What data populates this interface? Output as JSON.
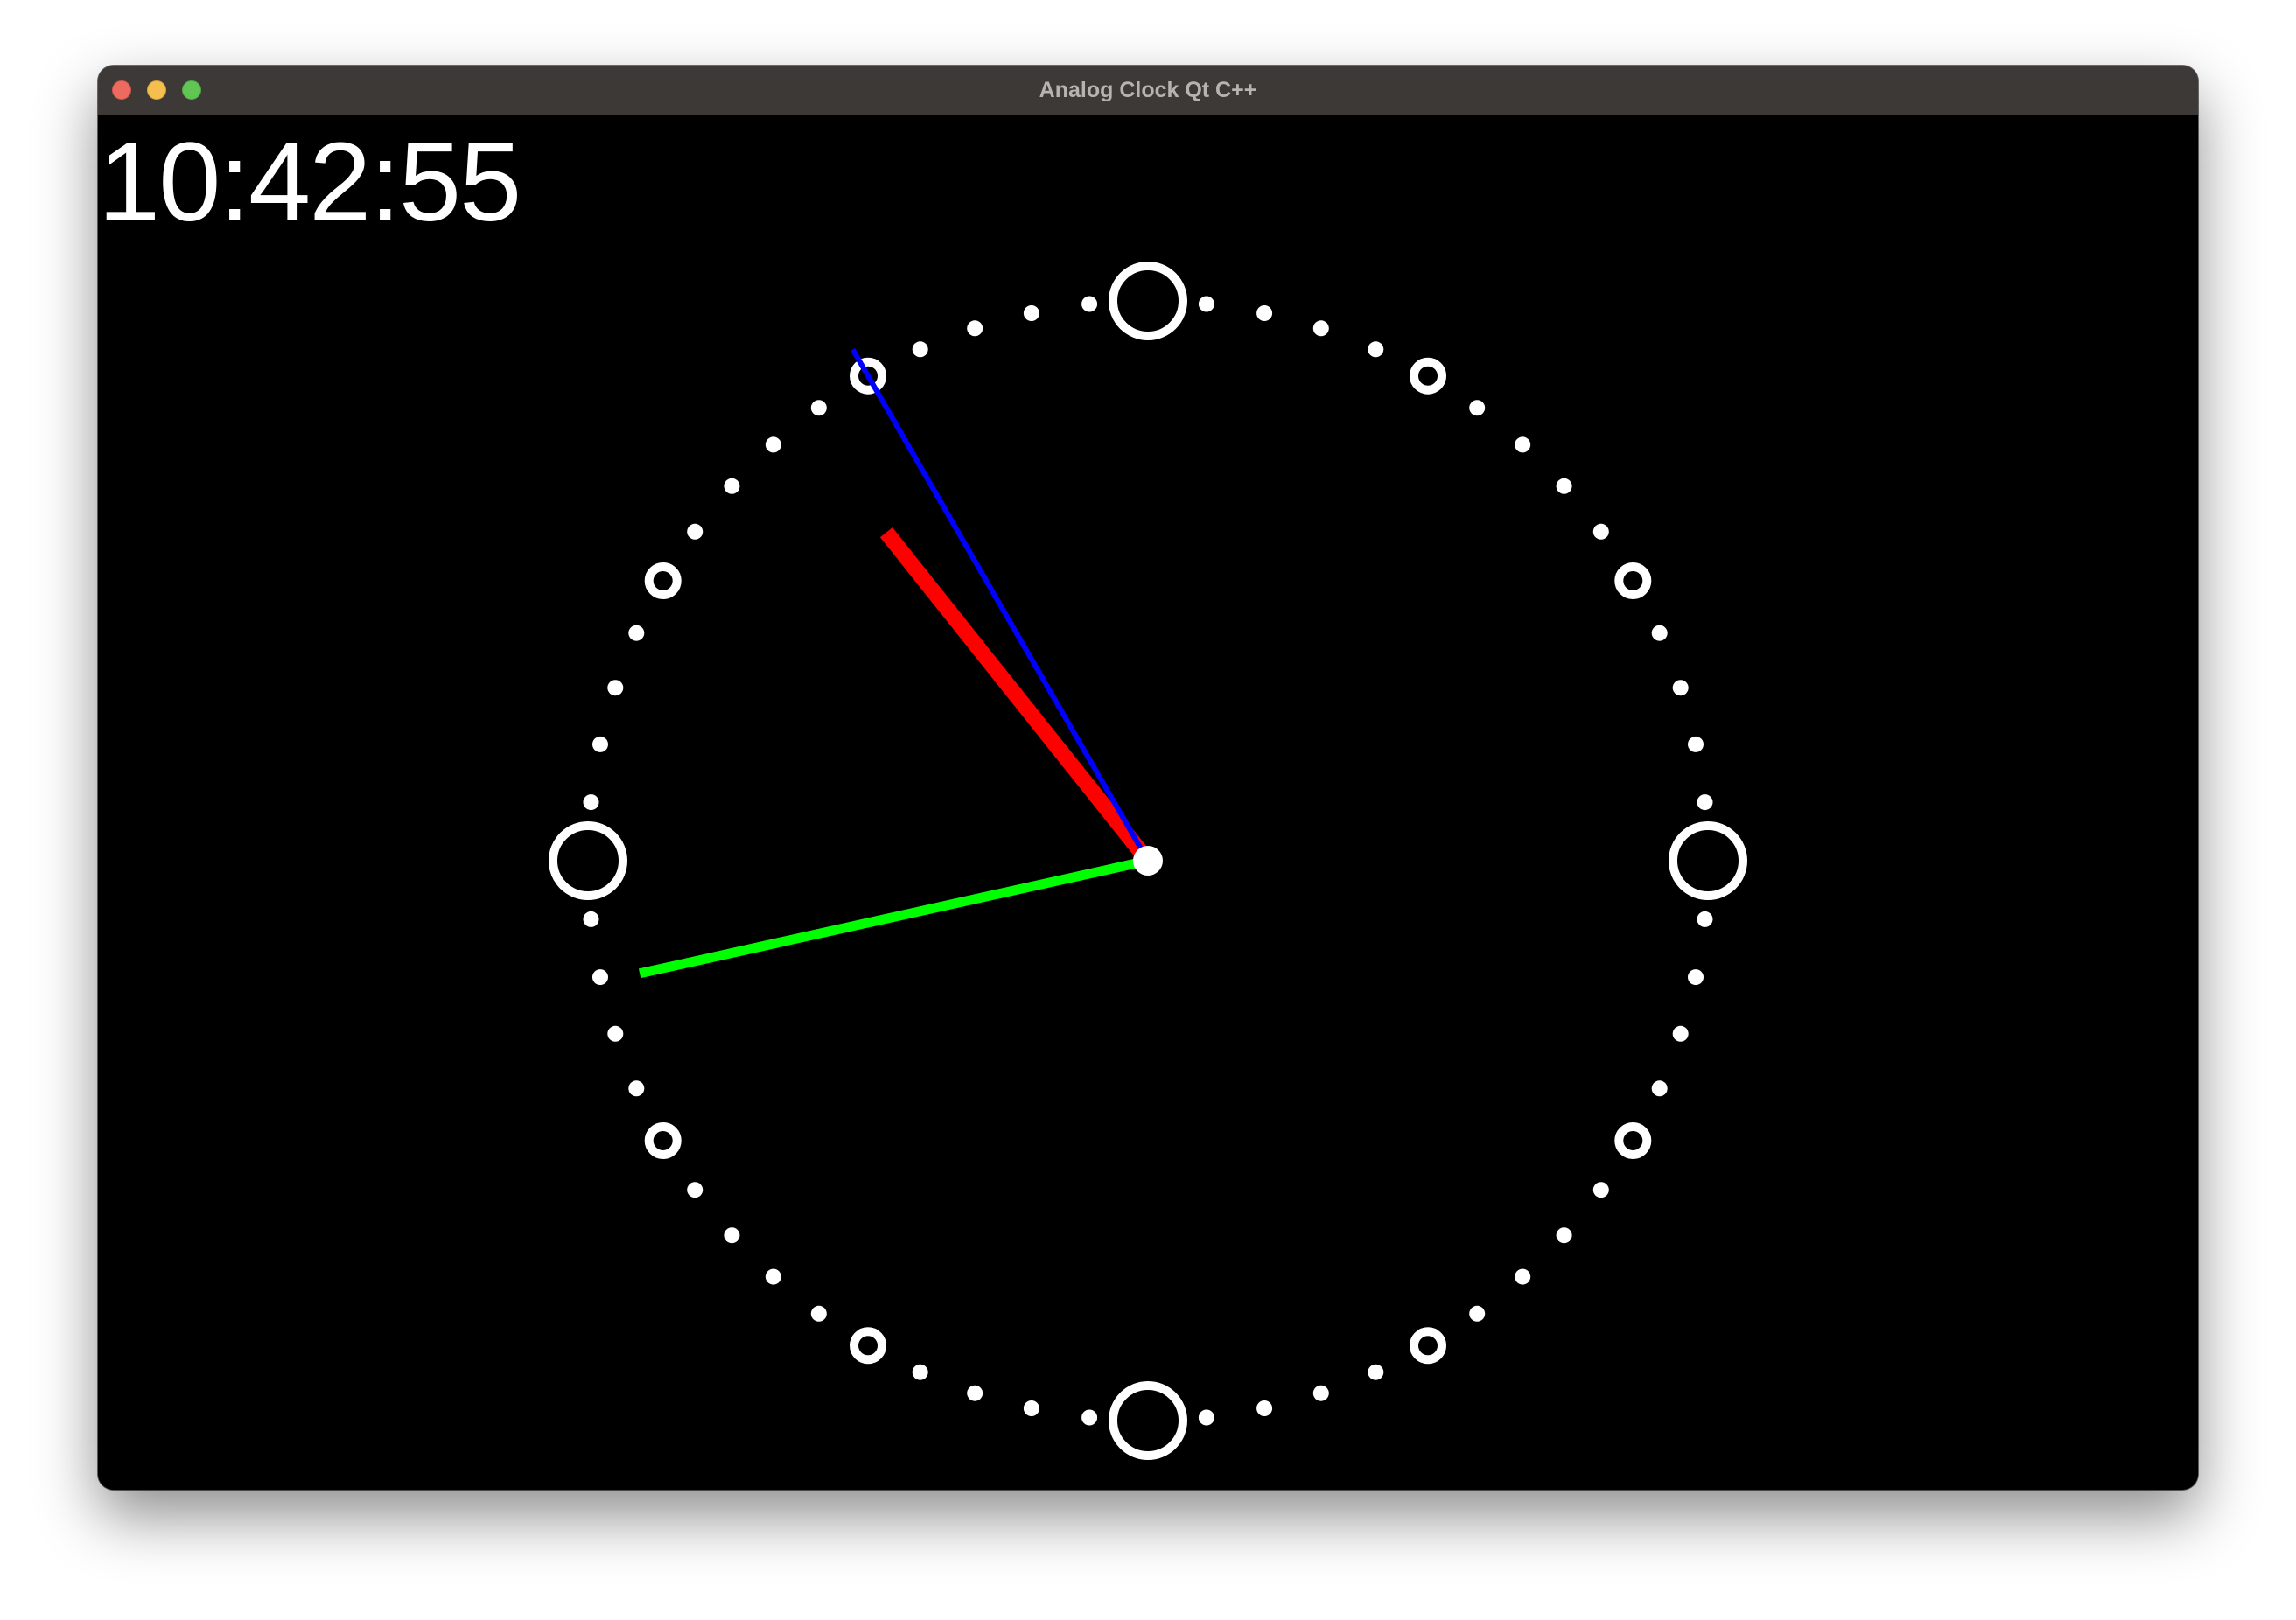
{
  "window": {
    "title": "Analog Clock Qt C++"
  },
  "clock": {
    "digital_time": "10:42:55",
    "hours": 10,
    "minutes": 42,
    "seconds": 55,
    "colors": {
      "background": "#000000",
      "markers": "#ffffff",
      "hour_hand": "#ff0000",
      "minute_hand": "#00ff00",
      "second_hand": "#0000ff",
      "center": "#ffffff"
    },
    "marker_style": {
      "quarter_hours": "large-ring",
      "hours": "small-ring",
      "minutes": "dot"
    }
  },
  "icons": {
    "close": "close-icon",
    "minimize": "minimize-icon",
    "zoom": "zoom-icon"
  }
}
